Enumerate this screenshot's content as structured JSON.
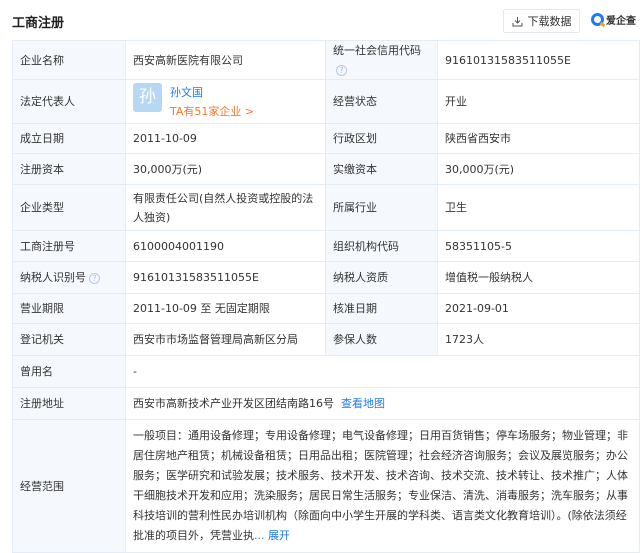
{
  "header": {
    "title": "工商注册",
    "download_label": "下载数据",
    "brand": "爱企查"
  },
  "rows": [
    {
      "l1": "企业名称",
      "v1": "西安高新医院有限公司",
      "l2": "统一社会信用代码",
      "v2": "91610131583511055E"
    },
    {
      "l1": "法定代表人",
      "avatar": "孙",
      "name": "孙文国",
      "companies": "TA有51家企业 >",
      "l2": "经营状态",
      "v2": "开业"
    },
    {
      "l1": "成立日期",
      "v1": "2011-10-09",
      "l2": "行政区划",
      "v2": "陕西省西安市"
    },
    {
      "l1": "注册资本",
      "v1": "30,000万(元)",
      "l2": "实缴资本",
      "v2": "30,000万(元)"
    },
    {
      "l1": "企业类型",
      "v1": "有限责任公司(自然人投资或控股的法人独资)",
      "l2": "所属行业",
      "v2": "卫生"
    },
    {
      "l1": "工商注册号",
      "v1": "6100004001190",
      "l2": "组织机构代码",
      "v2": "58351105-5"
    },
    {
      "l1": "纳税人识别号",
      "v1": "91610131583511055E",
      "l2": "纳税人资质",
      "v2": "增值税一般纳税人"
    },
    {
      "l1": "营业期限",
      "v1": "2011-10-09 至 无固定期限",
      "l2": "核准日期",
      "v2": "2021-09-01"
    },
    {
      "l1": "登记机关",
      "v1": "西安市市场监督管理局高新区分局",
      "l2": "参保人数",
      "v2": "1723人"
    },
    {
      "l1": "曾用名",
      "v1": "-"
    },
    {
      "l1": "注册地址",
      "v1": "西安市高新技术产业开发区团结南路16号",
      "link": "查看地图"
    },
    {
      "l1": "经营范围",
      "v1": "一般项目：通用设备修理；专用设备修理；电气设备修理；日用百货销售；停车场服务；物业管理；非居住房地产租赁；机械设备租赁；日用品出租；医院管理；社会经济咨询服务；会议及展览服务；办公服务；医学研究和试验发展；技术服务、技术开发、技术咨询、技术交流、技术转让、技术推广；人体干细胞技术开发和应用；洗染服务；居民日常生活服务；专业保洁、清洗、消毒服务；洗车服务；从事科技培训的营利性民办培训机构（除面向中小学生开展的学科类、语言类文化教育培训）。(除依法须经批准的项目外，凭营业执",
      "more": "... 展开"
    }
  ]
}
